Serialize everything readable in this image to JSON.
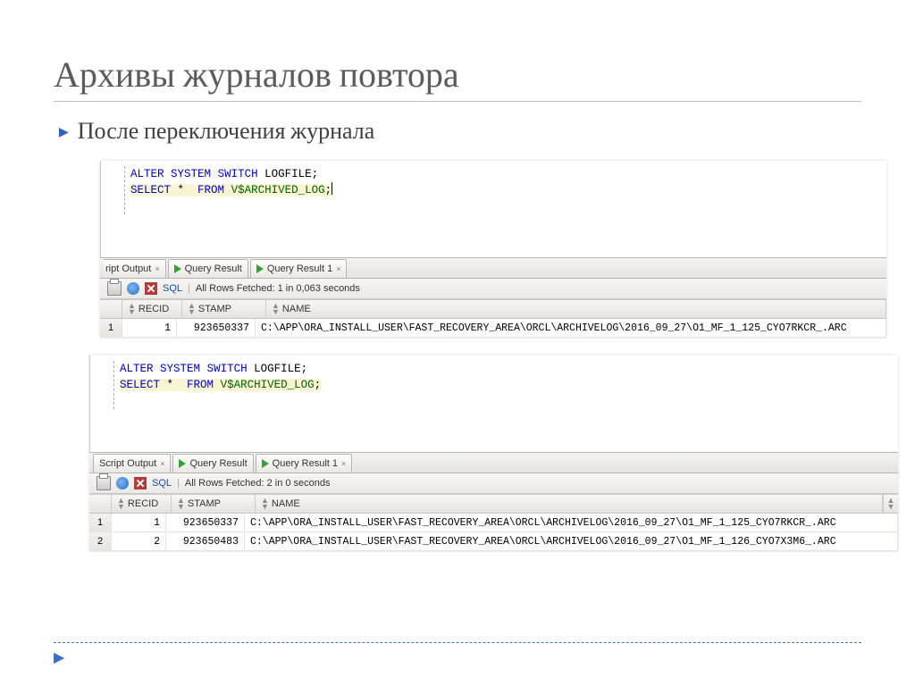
{
  "title": "Архивы журналов повтора",
  "bullet": "После переключения журнала",
  "panel1": {
    "sql_plain": "ALTER SYSTEM SWITCH LOGFILE;\nSELECT *  FROM V$ARCHIVED_LOG;",
    "tabs": {
      "script_output": "ript Output",
      "script_output_close": "×",
      "query_result": "Query Result",
      "query_result1": "Query Result 1",
      "query_result1_close": "×"
    },
    "toolbar": {
      "sql_link": "SQL",
      "fetched": "All Rows Fetched: 1 in 0,063 seconds"
    },
    "columns": {
      "recid": "RECID",
      "stamp": "STAMP",
      "name": "NAME"
    },
    "rows": [
      {
        "idx": "1",
        "recid": "1",
        "stamp": "923650337",
        "name": "C:\\APP\\ORA_INSTALL_USER\\FAST_RECOVERY_AREA\\ORCL\\ARCHIVELOG\\2016_09_27\\O1_MF_1_125_CYO7RKCR_.ARC"
      }
    ]
  },
  "panel2": {
    "sql_plain": "ALTER SYSTEM SWITCH LOGFILE;\nSELECT *  FROM V$ARCHIVED_LOG;",
    "tabs": {
      "script_output": "Script Output",
      "script_output_close": "×",
      "query_result": "Query Result",
      "query_result1": "Query Result 1",
      "query_result1_close": "×"
    },
    "toolbar": {
      "sql_link": "SQL",
      "fetched": "All Rows Fetched: 2 in 0 seconds"
    },
    "columns": {
      "recid": "RECID",
      "stamp": "STAMP",
      "name": "NAME"
    },
    "rows": [
      {
        "idx": "1",
        "recid": "1",
        "stamp": "923650337",
        "name": "C:\\APP\\ORA_INSTALL_USER\\FAST_RECOVERY_AREA\\ORCL\\ARCHIVELOG\\2016_09_27\\O1_MF_1_125_CYO7RKCR_.ARC"
      },
      {
        "idx": "2",
        "recid": "2",
        "stamp": "923650483",
        "name": "C:\\APP\\ORA_INSTALL_USER\\FAST_RECOVERY_AREA\\ORCL\\ARCHIVELOG\\2016_09_27\\O1_MF_1_126_CYO7X3M6_.ARC"
      }
    ]
  }
}
